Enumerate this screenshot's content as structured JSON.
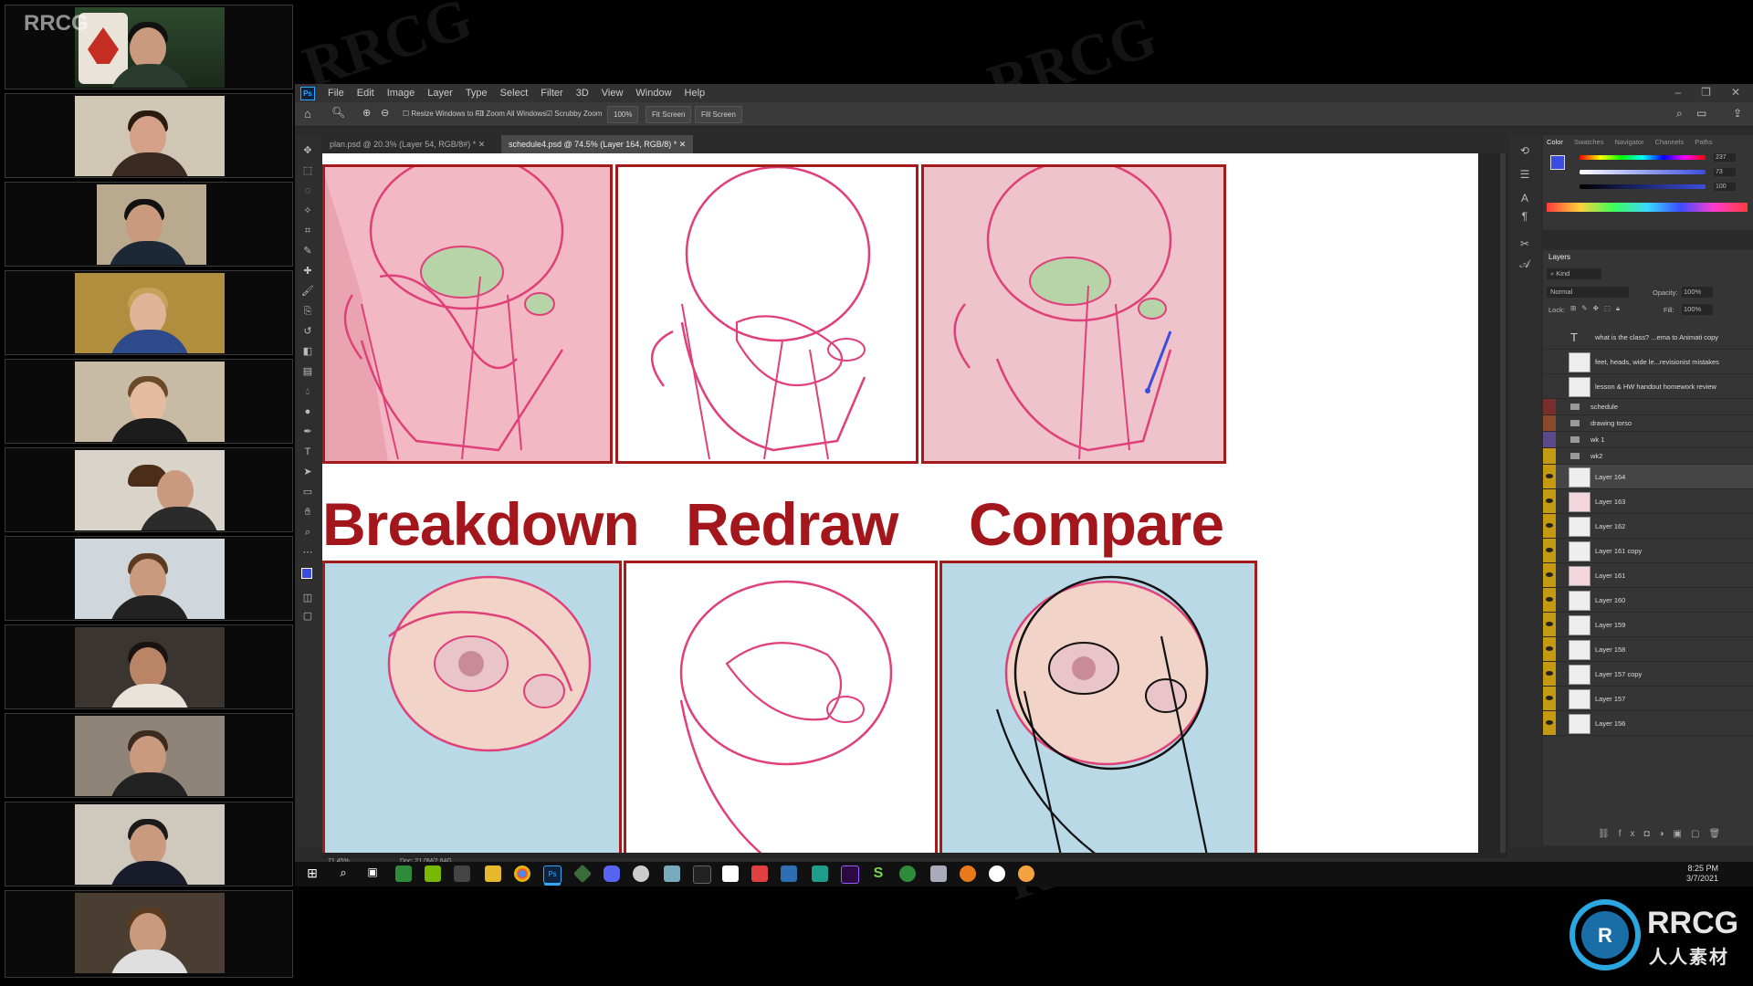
{
  "watermark": {
    "corner_text": "RRCG",
    "brand_text": "RRCG",
    "brand_subtext": "人人素材"
  },
  "participants": [
    {
      "label": "participant-1"
    },
    {
      "label": "participant-2"
    },
    {
      "label": "participant-3"
    },
    {
      "label": "participant-4"
    },
    {
      "label": "participant-5"
    },
    {
      "label": "participant-6"
    },
    {
      "label": "participant-7"
    },
    {
      "label": "participant-8"
    },
    {
      "label": "participant-9"
    },
    {
      "label": "participant-10"
    },
    {
      "label": "participant-11"
    }
  ],
  "menu": {
    "logo": "Ps",
    "items": [
      "File",
      "Edit",
      "Image",
      "Layer",
      "Type",
      "Select",
      "Filter",
      "3D",
      "View",
      "Window",
      "Help"
    ]
  },
  "options": {
    "resize_windows": "Resize Windows to Fit",
    "zoom_all": "Zoom All Windows",
    "scrubby_zoom": "Scrubby Zoom",
    "zoom_value": "100%",
    "fit_screen": "Fit Screen",
    "fill_screen": "Fill Screen"
  },
  "tabs": [
    {
      "label": "plan.psd @ 20.3% (Layer 54, RGB/8#) *"
    },
    {
      "label": "schedule4.psd @ 74.5% (Layer 164, RGB/8) *"
    }
  ],
  "document": {
    "headings": [
      "Breakdown",
      "Redraw",
      "Compare"
    ]
  },
  "status": {
    "zoom": "71.45%",
    "doc": "Doc: 21.0M/2.84G"
  },
  "color_panel": {
    "tabs": [
      "Color",
      "Swatches",
      "Navigator",
      "Channels",
      "Paths"
    ],
    "values": [
      "237",
      "73",
      "100"
    ],
    "foreground": "#3a4de0",
    "background": "#ffffff"
  },
  "layers_panel": {
    "title": "Layers",
    "kind_label": "Kind",
    "blend_mode": "Normal",
    "opacity_label": "Opacity:",
    "opacity_value": "100%",
    "lock_label": "Lock:",
    "fill_label": "Fill:",
    "fill_value": "100%",
    "text_layers": [
      "what is the class? ...ema to Animati copy",
      "feet, heads, wide le...revisionist mistakes",
      "lesson & HW handout homework review"
    ],
    "groups": [
      "schedule",
      "drawing torso",
      "wk 1",
      "wk2"
    ],
    "layers": [
      "Layer 164",
      "Layer 163",
      "Layer 162",
      "Layer 161 copy",
      "Layer 161",
      "Layer 160",
      "Layer 159",
      "Layer 158",
      "Layer 157 copy",
      "Layer 157",
      "Layer 156"
    ]
  },
  "taskbar": {
    "time": "8:25 PM",
    "date": "3/7/2021"
  },
  "accent_colors": {
    "heading_red": "#a3161b",
    "sketch_pink": "#e0407a",
    "eye_yellow": "#c49a12"
  }
}
